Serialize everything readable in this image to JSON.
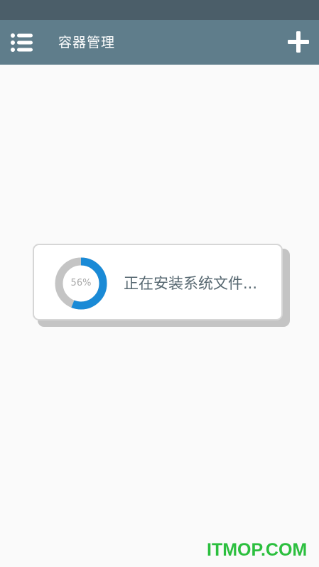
{
  "app_bar": {
    "menu_icon": "list-menu-icon",
    "title": "容器管理",
    "add_icon": "plus-icon"
  },
  "progress_dialog": {
    "progress_percent": 56,
    "progress_label": "56%",
    "message": "正在安装系统文件...",
    "ring_color": "#1a8ad6",
    "ring_track_color": "#c4c4c4"
  },
  "watermark": {
    "text": "ITMOP.COM",
    "color": "#2bbf3e"
  },
  "colors": {
    "status_bar": "#4b5e69",
    "app_bar": "#5f7d8b",
    "background": "#fafafa"
  }
}
